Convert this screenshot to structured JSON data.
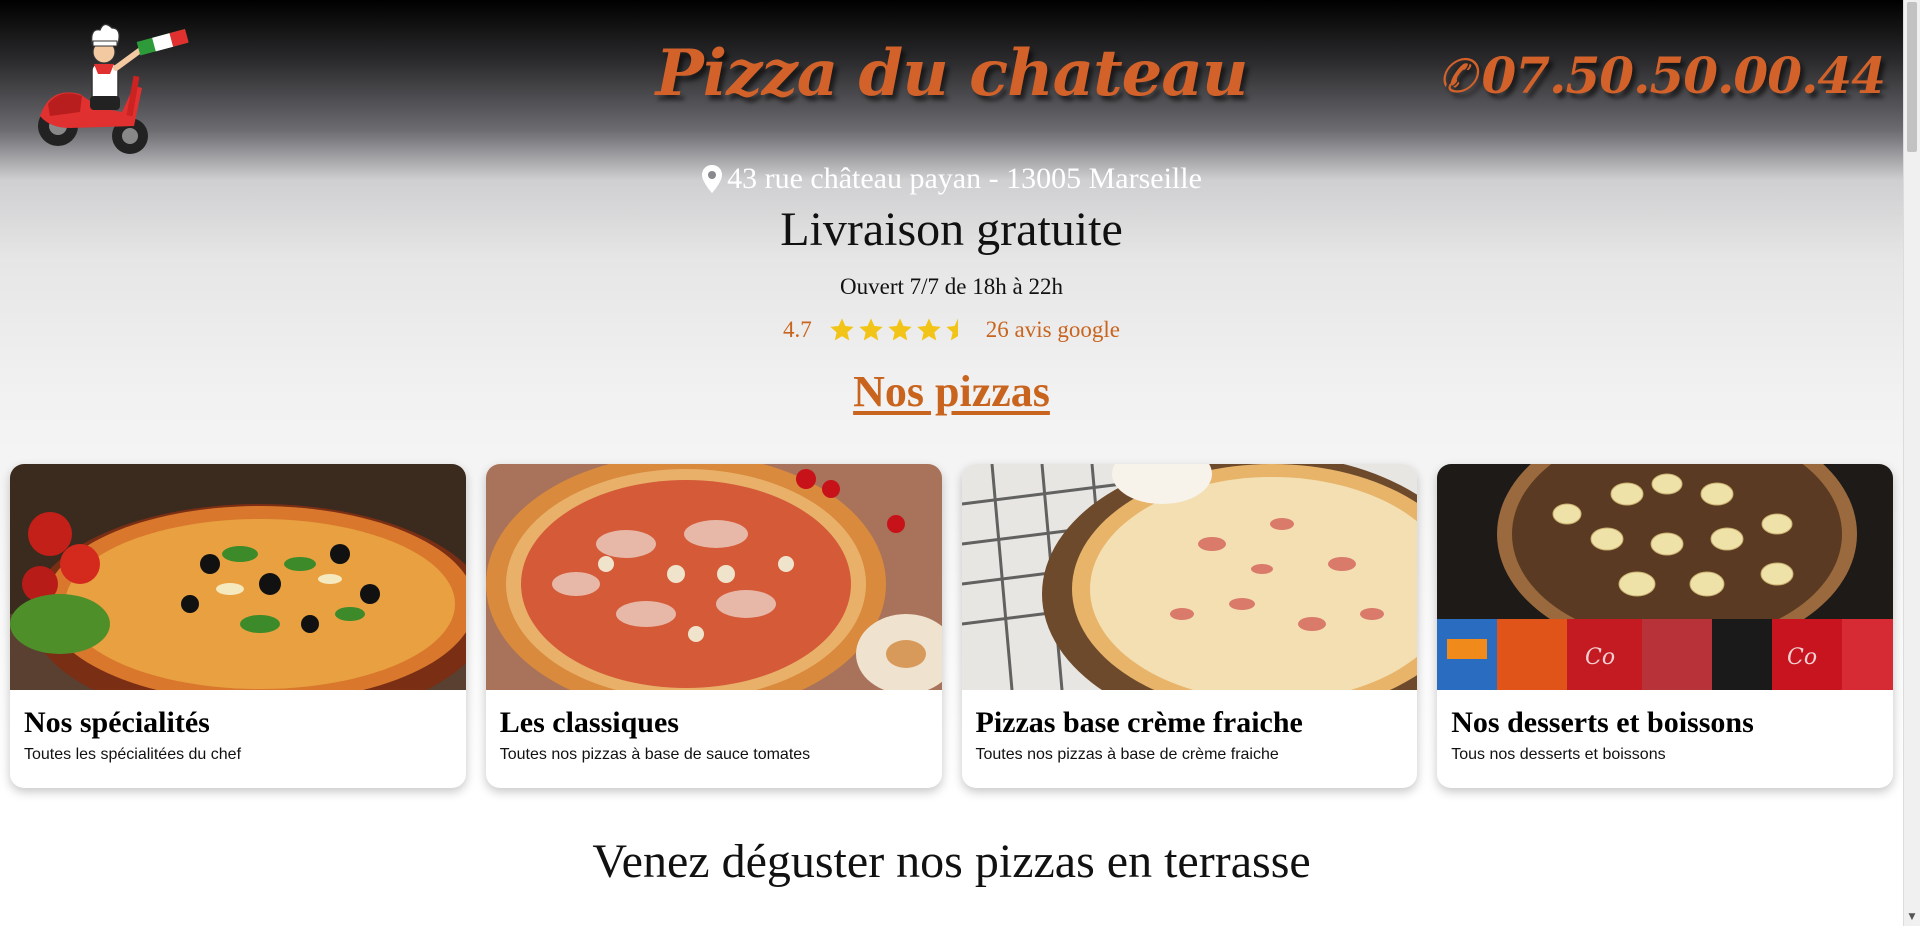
{
  "header": {
    "brand": "Pizza du chateau",
    "phone": "07.50.50.00.44",
    "phone_icon": "phone-icon",
    "logo_icon": "scooter-chef-logo"
  },
  "info": {
    "address": "43 rue château payan - 13005 Marseille",
    "address_icon": "map-pin-icon",
    "delivery": "Livraison gratuite",
    "hours": "Ouvert 7/7 de 18h à 22h",
    "rating_value": "4.7",
    "rating_stars": 4.5,
    "reviews": "26 avis google"
  },
  "section": {
    "title": "Nos pizzas"
  },
  "cards": [
    {
      "title": "Nos spécialités",
      "desc": "Toutes les spécialitées du chef"
    },
    {
      "title": "Les classiques",
      "desc": "Toutes nos pizzas à base de sauce tomates"
    },
    {
      "title": "Pizzas base crème fraiche",
      "desc": "Toutes nos pizzas à base de crème fraiche"
    },
    {
      "title": "Nos desserts et boissons",
      "desc": "Tous nos desserts et boissons"
    }
  ],
  "terrace": "Venez déguster nos pizzas en terrasse",
  "colors": {
    "accent": "#c8641e",
    "brand": "#d2622a",
    "star": "#f2c418"
  }
}
